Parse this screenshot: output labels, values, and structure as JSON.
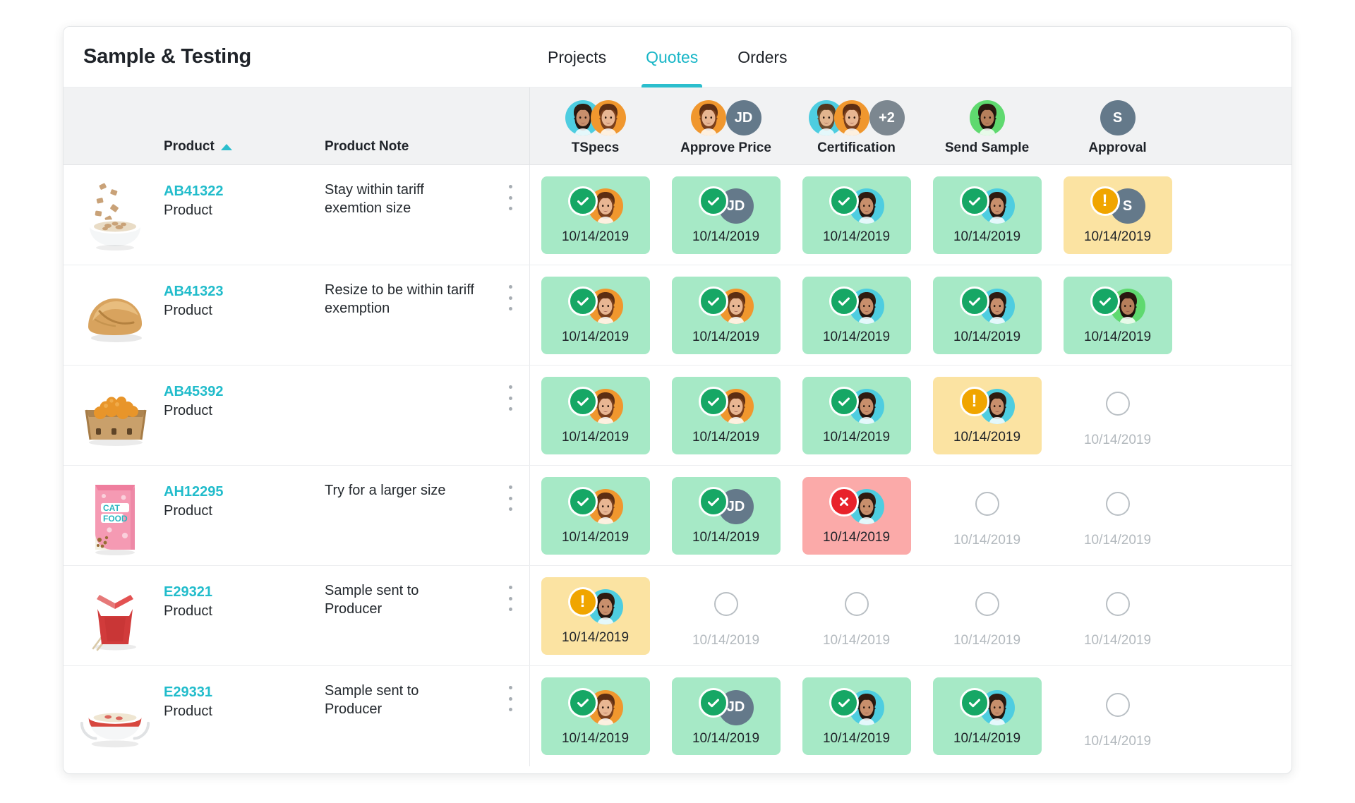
{
  "header": {
    "title": "Sample & Testing",
    "tabs": [
      {
        "label": "Projects",
        "active": false
      },
      {
        "label": "Quotes",
        "active": true
      },
      {
        "label": "Orders",
        "active": false
      }
    ]
  },
  "columns": {
    "product": {
      "label": "Product",
      "sort": "asc",
      "sort_icon": "caret-up-icon"
    },
    "note": {
      "label": "Product Note"
    },
    "stages": [
      {
        "label": "TSpecs",
        "avatars": [
          {
            "type": "photo",
            "id": "woman-teal-bg"
          },
          {
            "type": "photo",
            "id": "woman-orange-bg"
          }
        ]
      },
      {
        "label": "Approve Price",
        "avatars": [
          {
            "type": "photo",
            "id": "woman-orange-bg"
          },
          {
            "type": "initials",
            "text": "JD"
          }
        ]
      },
      {
        "label": "Certification",
        "avatars": [
          {
            "type": "photo",
            "id": "man-teal-bg"
          },
          {
            "type": "photo",
            "id": "woman-orange-bg"
          },
          {
            "type": "more",
            "text": "+2"
          }
        ]
      },
      {
        "label": "Send Sample",
        "avatars": [
          {
            "type": "photo",
            "id": "woman-green-bg"
          }
        ]
      },
      {
        "label": "Approval",
        "avatars": [
          {
            "type": "initials",
            "text": "S"
          }
        ]
      }
    ]
  },
  "rows": [
    {
      "thumb": "cereal-bowl-icon",
      "code": "AB41322",
      "subtitle": "Product",
      "note": "Stay within tariff exemtion size",
      "menu_icon": "kebab-menu-icon",
      "cells": [
        {
          "state": "ok",
          "date": "10/14/2019",
          "avatar": {
            "type": "photo",
            "id": "woman-orange-bg"
          }
        },
        {
          "state": "ok",
          "date": "10/14/2019",
          "avatar": {
            "type": "initials",
            "text": "JD"
          }
        },
        {
          "state": "ok",
          "date": "10/14/2019",
          "avatar": {
            "type": "photo",
            "id": "woman-teal-bg"
          }
        },
        {
          "state": "ok",
          "date": "10/14/2019",
          "avatar": {
            "type": "photo",
            "id": "woman-teal-bg"
          }
        },
        {
          "state": "warn",
          "date": "10/14/2019",
          "avatar": {
            "type": "initials",
            "text": "S"
          }
        }
      ]
    },
    {
      "thumb": "bread-loaf-icon",
      "code": "AB41323",
      "subtitle": "Product",
      "note": "Resize to be within tariff exemption",
      "menu_icon": "kebab-menu-icon",
      "cells": [
        {
          "state": "ok",
          "date": "10/14/2019",
          "avatar": {
            "type": "photo",
            "id": "woman-orange-bg"
          }
        },
        {
          "state": "ok",
          "date": "10/14/2019",
          "avatar": {
            "type": "photo",
            "id": "woman-orange-bg"
          }
        },
        {
          "state": "ok",
          "date": "10/14/2019",
          "avatar": {
            "type": "photo",
            "id": "woman-teal-bg"
          }
        },
        {
          "state": "ok",
          "date": "10/14/2019",
          "avatar": {
            "type": "photo",
            "id": "woman-teal-bg"
          }
        },
        {
          "state": "ok",
          "date": "10/14/2019",
          "avatar": {
            "type": "photo",
            "id": "woman-green-bg"
          }
        }
      ]
    },
    {
      "thumb": "orange-crate-icon",
      "code": "AB45392",
      "subtitle": "Product",
      "note": "",
      "menu_icon": "kebab-menu-icon",
      "cells": [
        {
          "state": "ok",
          "date": "10/14/2019",
          "avatar": {
            "type": "photo",
            "id": "woman-orange-bg"
          }
        },
        {
          "state": "ok",
          "date": "10/14/2019",
          "avatar": {
            "type": "photo",
            "id": "woman-orange-bg"
          }
        },
        {
          "state": "ok",
          "date": "10/14/2019",
          "avatar": {
            "type": "photo",
            "id": "woman-teal-bg"
          }
        },
        {
          "state": "warn",
          "date": "10/14/2019",
          "avatar": {
            "type": "photo",
            "id": "woman-teal-bg"
          }
        },
        {
          "state": "empty",
          "date": "10/14/2019",
          "avatar": null
        }
      ]
    },
    {
      "thumb": "cat-food-pouch-icon",
      "code": "AH12295",
      "subtitle": "Product",
      "note": "Try for a larger size",
      "menu_icon": "kebab-menu-icon",
      "cells": [
        {
          "state": "ok",
          "date": "10/14/2019",
          "avatar": {
            "type": "photo",
            "id": "woman-orange-bg"
          }
        },
        {
          "state": "ok",
          "date": "10/14/2019",
          "avatar": {
            "type": "initials",
            "text": "JD"
          }
        },
        {
          "state": "error",
          "date": "10/14/2019",
          "avatar": {
            "type": "photo",
            "id": "woman-teal-bg"
          }
        },
        {
          "state": "empty",
          "date": "10/14/2019",
          "avatar": null
        },
        {
          "state": "empty",
          "date": "10/14/2019",
          "avatar": null
        }
      ]
    },
    {
      "thumb": "takeout-box-icon",
      "code": "E29321",
      "subtitle": "Product",
      "note": "Sample sent to Producer",
      "menu_icon": "kebab-menu-icon",
      "cells": [
        {
          "state": "warn",
          "date": "10/14/2019",
          "avatar": {
            "type": "photo",
            "id": "woman-teal-bg"
          }
        },
        {
          "state": "empty",
          "date": "10/14/2019",
          "avatar": null
        },
        {
          "state": "empty",
          "date": "10/14/2019",
          "avatar": null
        },
        {
          "state": "empty",
          "date": "10/14/2019",
          "avatar": null
        },
        {
          "state": "empty",
          "date": "10/14/2019",
          "avatar": null
        }
      ]
    },
    {
      "thumb": "soup-bowl-icon",
      "code": "E29331",
      "subtitle": "Product",
      "note": "Sample sent to Producer",
      "menu_icon": "kebab-menu-icon",
      "cells": [
        {
          "state": "ok",
          "date": "10/14/2019",
          "avatar": {
            "type": "photo",
            "id": "woman-orange-bg"
          }
        },
        {
          "state": "ok",
          "date": "10/14/2019",
          "avatar": {
            "type": "initials",
            "text": "JD"
          }
        },
        {
          "state": "ok",
          "date": "10/14/2019",
          "avatar": {
            "type": "photo",
            "id": "woman-teal-bg"
          }
        },
        {
          "state": "ok",
          "date": "10/14/2019",
          "avatar": {
            "type": "photo",
            "id": "woman-teal-bg"
          }
        },
        {
          "state": "empty",
          "date": "10/14/2019",
          "avatar": null
        }
      ]
    }
  ],
  "colors": {
    "accent": "#21bccb",
    "ok": "#a6e9c6",
    "ok_badge": "#16a765",
    "warn": "#fbe3a2",
    "warn_badge": "#f0a500",
    "error": "#fbaaa9",
    "error_badge": "#e8222a",
    "header_bg": "#f1f2f3"
  }
}
